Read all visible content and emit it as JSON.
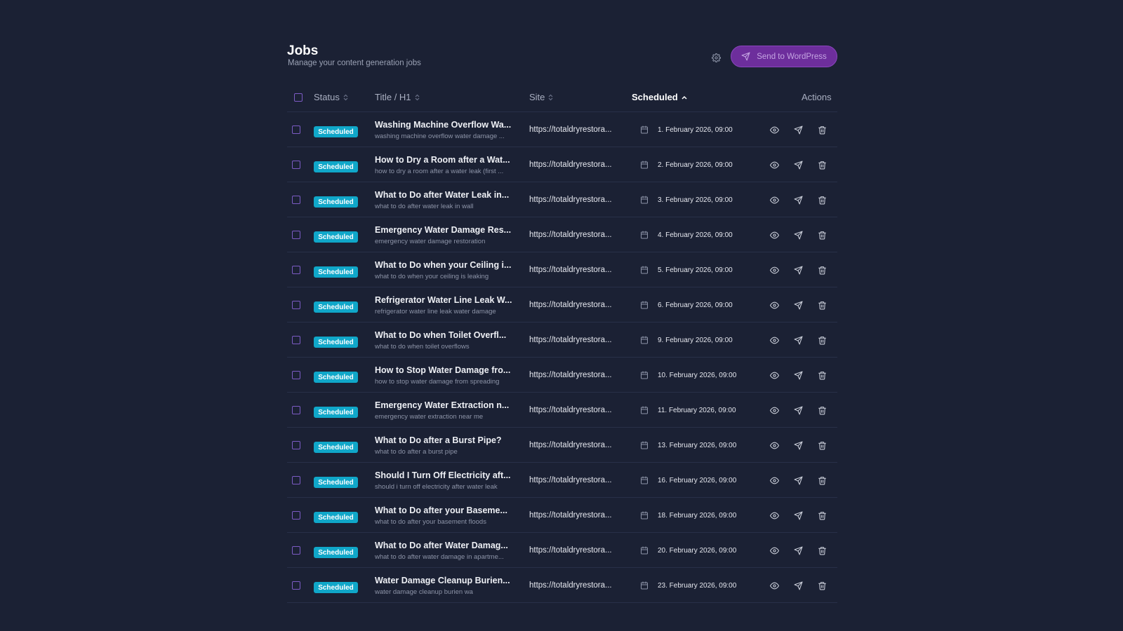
{
  "header": {
    "title": "Jobs",
    "subtitle": "Manage your content generation jobs",
    "send_button_label": "Send to WordPress"
  },
  "columns": {
    "status": "Status",
    "title": "Title / H1",
    "site": "Site",
    "scheduled": "Scheduled",
    "actions": "Actions"
  },
  "colors": {
    "background": "#1b2134",
    "accent": "#6d2e9c",
    "status_badge": "#10a7c9",
    "checkbox": "#7c5bc4"
  },
  "rows": [
    {
      "status": "Scheduled",
      "title": "Washing Machine Overflow Wa...",
      "keyword": "washing machine overflow water damage ...",
      "site": "https://totaldryrestora...",
      "scheduled": "1. February 2026, 09:00"
    },
    {
      "status": "Scheduled",
      "title": "How to Dry a Room after a Wat...",
      "keyword": "how to dry a room after a water leak (first ...",
      "site": "https://totaldryrestora...",
      "scheduled": "2. February 2026, 09:00"
    },
    {
      "status": "Scheduled",
      "title": "What to Do after Water Leak in...",
      "keyword": "what to do after water leak in wall",
      "site": "https://totaldryrestora...",
      "scheduled": "3. February 2026, 09:00"
    },
    {
      "status": "Scheduled",
      "title": "Emergency Water Damage Res...",
      "keyword": "emergency water damage restoration",
      "site": "https://totaldryrestora...",
      "scheduled": "4. February 2026, 09:00"
    },
    {
      "status": "Scheduled",
      "title": "What to Do when your Ceiling i...",
      "keyword": "what to do when your ceiling is leaking",
      "site": "https://totaldryrestora...",
      "scheduled": "5. February 2026, 09:00"
    },
    {
      "status": "Scheduled",
      "title": "Refrigerator Water Line Leak W...",
      "keyword": "refrigerator water line leak water damage",
      "site": "https://totaldryrestora...",
      "scheduled": "6. February 2026, 09:00"
    },
    {
      "status": "Scheduled",
      "title": "What to Do when Toilet Overfl...",
      "keyword": "what to do when toilet overflows",
      "site": "https://totaldryrestora...",
      "scheduled": "9. February 2026, 09:00"
    },
    {
      "status": "Scheduled",
      "title": "How to Stop Water Damage fro...",
      "keyword": "how to stop water damage from spreading",
      "site": "https://totaldryrestora...",
      "scheduled": "10. February 2026, 09:00"
    },
    {
      "status": "Scheduled",
      "title": "Emergency Water Extraction n...",
      "keyword": "emergency water extraction near me",
      "site": "https://totaldryrestora...",
      "scheduled": "11. February 2026, 09:00"
    },
    {
      "status": "Scheduled",
      "title": "What to Do after a Burst Pipe?",
      "keyword": "what to do after a burst pipe",
      "site": "https://totaldryrestora...",
      "scheduled": "13. February 2026, 09:00"
    },
    {
      "status": "Scheduled",
      "title": "Should I Turn Off Electricity aft...",
      "keyword": "should i turn off electricity after water leak",
      "site": "https://totaldryrestora...",
      "scheduled": "16. February 2026, 09:00"
    },
    {
      "status": "Scheduled",
      "title": "What to Do after your Baseme...",
      "keyword": "what to do after your basement floods",
      "site": "https://totaldryrestora...",
      "scheduled": "18. February 2026, 09:00"
    },
    {
      "status": "Scheduled",
      "title": "What to Do after Water Damag...",
      "keyword": "what to do after water damage in apartme...",
      "site": "https://totaldryrestora...",
      "scheduled": "20. February 2026, 09:00"
    },
    {
      "status": "Scheduled",
      "title": "Water Damage Cleanup Burien...",
      "keyword": "water damage cleanup burien wa",
      "site": "https://totaldryrestora...",
      "scheduled": "23. February 2026, 09:00"
    }
  ]
}
